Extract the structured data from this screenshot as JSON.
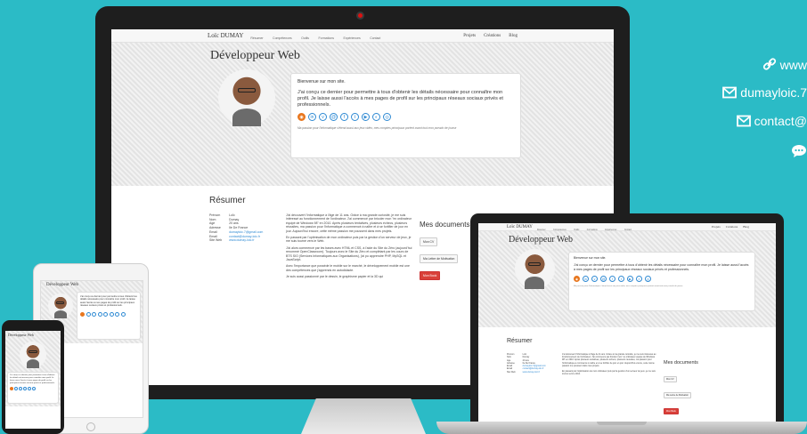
{
  "colors": {
    "background": "#2bbbc6",
    "accent": "#2f8ad3",
    "button_red": "#d9413a"
  },
  "site": {
    "brand": "Loïc DUMAY",
    "menu": [
      "Résumer",
      "Compétences",
      "Outils",
      "Formations",
      "Expériences",
      "Contact"
    ],
    "right_links": [
      "Projets",
      "Créations",
      "Blog"
    ],
    "hero_title": "Développeur Web",
    "welcome": "Bienvenue sur mon site.",
    "intro": "J'ai conçu ce dernier pour permettre à tous d'obtenir les détails nécessaire pour connaître mon profil. Je laisse aussi l'accès à mes pages de profil sur les principaux réseaux sociaux privés et professionnels.",
    "tagline": "Ma passion pour l'informatique s'étend aussi aux jeux vidéo, mes comptes principaux portent avant tout mon pseudo de joueur",
    "socials": [
      "rss-icon",
      "linkedin-icon",
      "viadeo-icon",
      "at-icon",
      "facebook-icon",
      "twitter-icon",
      "youtube-icon",
      "github-icon",
      "gamepad-icon"
    ],
    "socials_glyphs": [
      "◉",
      "in",
      "v",
      "@",
      "f",
      "t",
      "▶",
      "◐",
      "◎"
    ],
    "resume_title": "Résumer",
    "info_labels": [
      "Prénom",
      "Nom",
      "Age",
      "Adresse",
      "Email",
      "Email",
      "Site Web"
    ],
    "info_values": [
      "Loïc",
      "Dumay",
      "20 ans",
      "Ile De France",
      "dumayloic.7@gmail.com",
      "contact@dumay-loic.fr",
      "www.dumay-loic.fr"
    ],
    "bio": [
      "J'ai découvert l'informatique à l'âge de 11 ans. Grâce à ma grande curiosité, je me suis intéressé au fonctionnement de l'ordinateur. J'ai commencé par bricoler mon \"ex ordinateur équipé de Windows 98\" en 2010. Après plusieurs tentatives, plusieurs échecs, plusieurs réussites, ma passion pour l'informatique a commencé à naître et à se fortifier de jour en jour. Aujourd'hui encore, cette même passion me poussent dans mes projets.",
      "En passant par l'optimisation de mon ordinateur puis par la gestion d'un serveur de jeux, je me suis tourné vers le Web.",
      "J'ai alors commencé par les bases avec HTML et CSS, à l'aide du Site du Zéro (aujourd'hui renommé OpenClassroom). Toujours avec le Site du Zéro et complétant par les cours de BTS SIO (Services Informatiques aux Organisations), j'ai pu apprendre PHP, MySQL et JavaScript.",
      "Avec l'importance que possède le mobile sur le marché, le développement mobile est une des compétences que j'apprends en autodidacte.",
      "Je suis aussi passionné par le dessin, le graphisme papier et la 3D qui"
    ],
    "docs_title": "Mes documents",
    "docs_buttons": [
      "Mon CV",
      "Ma Lettre de Motivation",
      "Mon Book"
    ]
  },
  "contact": {
    "website": "www",
    "email_gmail": "dumayloic.7",
    "email_contact": "contact@"
  }
}
